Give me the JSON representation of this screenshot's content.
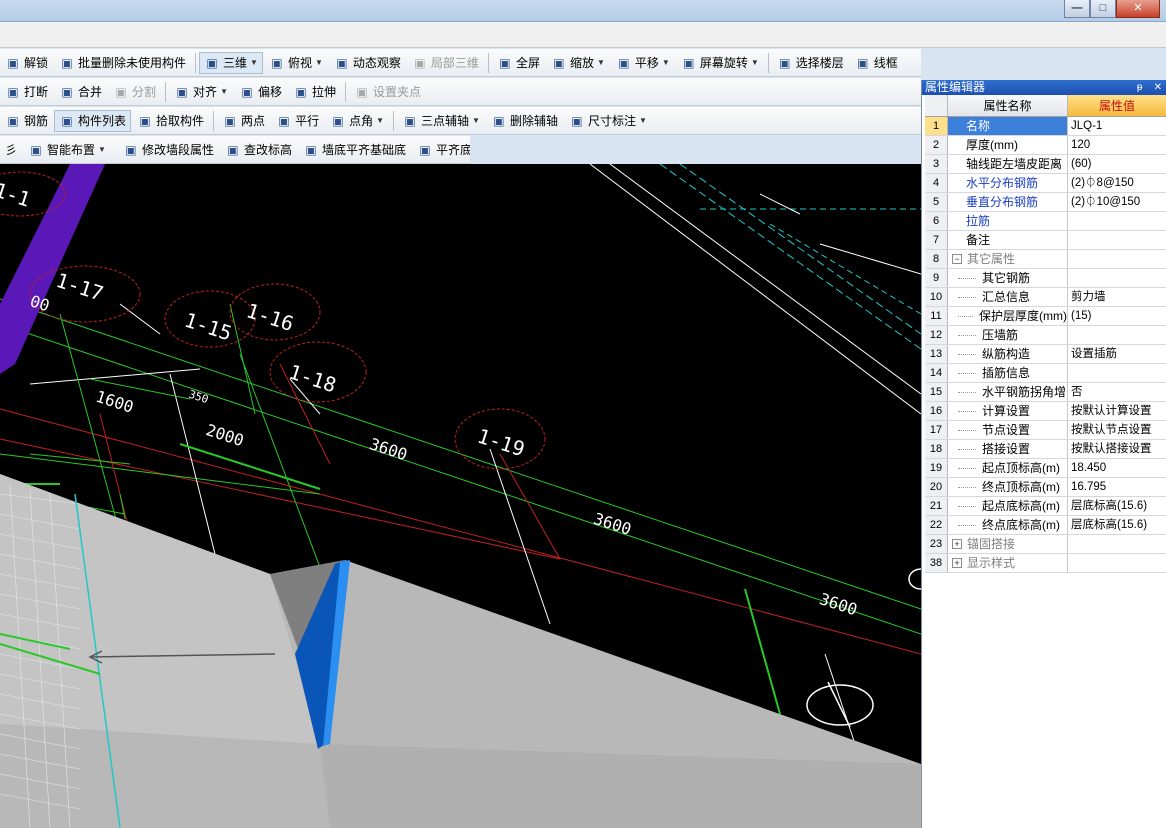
{
  "window": {
    "buttons": [
      "—",
      "□",
      "✕"
    ]
  },
  "toolbar1": {
    "items": [
      {
        "label": "解锁",
        "icon": "unlock-icon"
      },
      {
        "label": "批量删除未使用构件",
        "icon": "broom-icon"
      },
      {
        "label": "三维",
        "icon": "cube-3d-icon",
        "dropdown": true,
        "active": true
      },
      {
        "label": "俯视",
        "icon": "top-view-icon",
        "dropdown": true
      },
      {
        "label": "动态观察",
        "icon": "orbit-icon"
      },
      {
        "label": "局部三维",
        "icon": "local-3d-icon",
        "disabled": true
      },
      {
        "label": "全屏",
        "icon": "fullscreen-icon"
      },
      {
        "label": "缩放",
        "icon": "zoom-icon",
        "dropdown": true
      },
      {
        "label": "平移",
        "icon": "pan-icon",
        "dropdown": true
      },
      {
        "label": "屏幕旋转",
        "icon": "rotate-screen-icon",
        "dropdown": true
      },
      {
        "label": "选择楼层",
        "icon": "floor-select-icon"
      },
      {
        "label": "线框",
        "icon": "wireframe-icon"
      }
    ]
  },
  "toolbar2": {
    "items": [
      {
        "label": "打断",
        "icon": "break-icon"
      },
      {
        "label": "合并",
        "icon": "merge-icon"
      },
      {
        "label": "分割",
        "icon": "split-icon",
        "disabled": true
      },
      {
        "label": "对齐",
        "icon": "align-icon",
        "dropdown": true
      },
      {
        "label": "偏移",
        "icon": "offset-icon"
      },
      {
        "label": "拉伸",
        "icon": "stretch-icon"
      },
      {
        "label": "设置夹点",
        "icon": "grip-point-icon",
        "disabled": true
      }
    ]
  },
  "toolbar3": {
    "items": [
      {
        "label": "钢筋",
        "icon": "rebar-icon"
      },
      {
        "label": "构件列表",
        "icon": "component-list-icon",
        "active": true
      },
      {
        "label": "拾取构件",
        "icon": "pick-icon"
      },
      {
        "label": "两点",
        "icon": "two-point-icon"
      },
      {
        "label": "平行",
        "icon": "parallel-icon"
      },
      {
        "label": "点角",
        "icon": "point-angle-icon",
        "dropdown": true
      },
      {
        "label": "三点辅轴",
        "icon": "three-point-axis-icon",
        "dropdown": true
      },
      {
        "label": "删除辅轴",
        "icon": "delete-axis-icon"
      },
      {
        "label": "尺寸标注",
        "icon": "dimension-icon",
        "dropdown": true
      }
    ]
  },
  "toolbar4": {
    "items": [
      {
        "label": "彡",
        "icon": ""
      },
      {
        "label": "智能布置",
        "icon": "smart-layout-icon",
        "dropdown": true
      },
      {
        "label": "修改墙段属性",
        "icon": "edit-wall-icon"
      },
      {
        "label": "查改标高",
        "icon": "elevation-icon"
      },
      {
        "label": "墙底平齐基础底",
        "icon": "wall-align-base-icon"
      },
      {
        "label": "平齐底板",
        "icon": "align-slab-icon"
      }
    ]
  },
  "viewport": {
    "axis_labels": [
      "1-1",
      "1-17",
      "1-15",
      "1-16",
      "1-18",
      "1-19"
    ],
    "dimensions": [
      "1600",
      "350",
      "2000",
      "3600",
      "3600",
      "3600"
    ],
    "partial_labels": [
      "00"
    ]
  },
  "property_panel": {
    "title": "属性编辑器",
    "title_buttons": [
      "ᵽ",
      "✕"
    ],
    "col_name": "属性名称",
    "col_value": "属性值",
    "rows": [
      {
        "no": "1",
        "name": "名称",
        "value": "JLQ-1",
        "style": "blue",
        "selected": true
      },
      {
        "no": "2",
        "name": "厚度(mm)",
        "value": "120"
      },
      {
        "no": "3",
        "name": "轴线距左墙皮距离",
        "value": "(60)"
      },
      {
        "no": "4",
        "name": "水平分布钢筋",
        "value": "(2)⏀8@150",
        "style": "blue"
      },
      {
        "no": "5",
        "name": "垂直分布钢筋",
        "value": "(2)⏀10@150",
        "style": "blue"
      },
      {
        "no": "6",
        "name": "拉筋",
        "value": "",
        "style": "blue"
      },
      {
        "no": "7",
        "name": "备注",
        "value": ""
      },
      {
        "no": "8",
        "name": "其它属性",
        "value": "",
        "style": "gray",
        "expander": "−"
      },
      {
        "no": "9",
        "name": "其它钢筋",
        "value": "",
        "child": true
      },
      {
        "no": "10",
        "name": "汇总信息",
        "value": "剪力墙",
        "child": true
      },
      {
        "no": "11",
        "name": "保护层厚度(mm)",
        "value": "(15)",
        "child": true
      },
      {
        "no": "12",
        "name": "压墙筋",
        "value": "",
        "child": true
      },
      {
        "no": "13",
        "name": "纵筋构造",
        "value": "设置插筋",
        "child": true
      },
      {
        "no": "14",
        "name": "插筋信息",
        "value": "",
        "child": true
      },
      {
        "no": "15",
        "name": "水平钢筋拐角增",
        "value": "否",
        "child": true
      },
      {
        "no": "16",
        "name": "计算设置",
        "value": "按默认计算设置",
        "child": true
      },
      {
        "no": "17",
        "name": "节点设置",
        "value": "按默认节点设置",
        "child": true
      },
      {
        "no": "18",
        "name": "搭接设置",
        "value": "按默认搭接设置",
        "child": true
      },
      {
        "no": "19",
        "name": "起点顶标高(m)",
        "value": "18.450",
        "child": true
      },
      {
        "no": "20",
        "name": "终点顶标高(m)",
        "value": "16.795",
        "child": true
      },
      {
        "no": "21",
        "name": "起点底标高(m)",
        "value": "层底标高(15.6)",
        "child": true
      },
      {
        "no": "22",
        "name": "终点底标高(m)",
        "value": "层底标高(15.6)",
        "child": true
      },
      {
        "no": "23",
        "name": "锚固搭接",
        "value": "",
        "style": "gray",
        "expander": "+"
      },
      {
        "no": "38",
        "name": "显示样式",
        "value": "",
        "style": "gray",
        "expander": "+"
      }
    ]
  }
}
